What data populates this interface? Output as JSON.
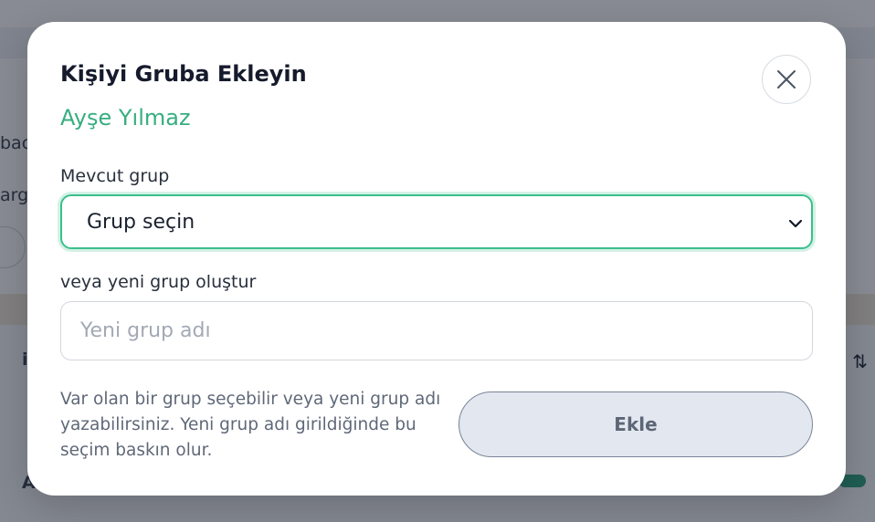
{
  "modal": {
    "title": "Kişiyi Gruba Ekleyin",
    "subtitle": "Ayşe Yılmaz",
    "close_icon": "close-icon",
    "existing_group": {
      "label": "Mevcut grup",
      "selected": "Grup seçin",
      "icon": "chevron-down-icon"
    },
    "new_group": {
      "label": "veya yeni grup oluştur",
      "value": "",
      "placeholder": "Yeni grup adı"
    },
    "help_text": "Var olan bir grup seçebilir veya yeni grup adı yazabilirsiniz. Yeni grup adı girildiğinde bu seçim baskın olur.",
    "submit_label": "Ekle"
  },
  "background": {
    "fragments": [
      "bac",
      "arg",
      "i",
      "A"
    ],
    "sort_icon": "sort-icon"
  },
  "colors": {
    "accent": "#37ae7f",
    "focus_border": "#3bbf8c",
    "button_bg": "#e3e8f0",
    "overlay": "rgba(17,24,39,0.5)"
  }
}
